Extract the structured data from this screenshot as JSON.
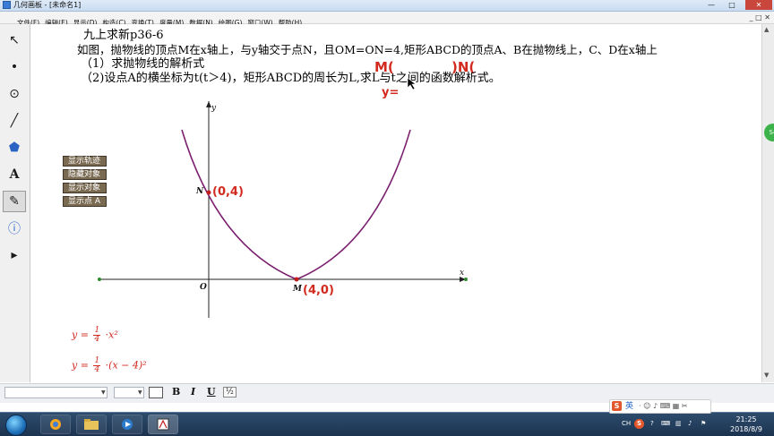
{
  "window": {
    "title": "几何画板 - [未命名1]",
    "minimize_glyph": "—",
    "maximize_glyph": "□",
    "close_glyph": "✕"
  },
  "menu": {
    "items": [
      "文件(F)",
      "编辑(E)",
      "显示(D)",
      "构造(C)",
      "变换(T)",
      "度量(M)",
      "数据(N)",
      "绘图(G)",
      "窗口(W)",
      "帮助(H)"
    ]
  },
  "tools": [
    {
      "name": "selection-arrow-tool",
      "glyph": "↖"
    },
    {
      "name": "point-tool",
      "glyph": "•"
    },
    {
      "name": "compass-tool",
      "glyph": "⊙"
    },
    {
      "name": "straightedge-tool",
      "glyph": "╱"
    },
    {
      "name": "polygon-tool",
      "glyph": "⬟"
    },
    {
      "name": "text-tool",
      "glyph": "A"
    },
    {
      "name": "marker-tool",
      "glyph": "✎"
    },
    {
      "name": "information-tool",
      "glyph": "ⓘ"
    },
    {
      "name": "custom-tool",
      "glyph": "▸"
    }
  ],
  "problem": {
    "line1": "九上求新p36-6",
    "line2": "如图，抛物线的顶点M在x轴上，与y轴交于点N，且OM=ON=4,矩形ABCD的顶点A、B在抛物线上，C、D在x轴上",
    "line3": "（1）求抛物线的解析式",
    "line4": "（2)设点A的横坐标为t(t＞4)，矩形ABCD的周长为L,求L与t之间的函数解析式。"
  },
  "action_buttons": [
    "显示轨迹",
    "隐藏对象",
    "显示对象",
    "显示点 A"
  ],
  "graph": {
    "x_axis_label": "x",
    "y_axis_label": "y",
    "origin_label": "O",
    "point_N_label": "N",
    "point_M_label": "M",
    "annotation_N": "(0,4)",
    "annotation_M": "(4,0)",
    "annotation_top_1": "M(",
    "annotation_top_2": ")N(",
    "annotation_top_3": "y=",
    "curve_color": "#7a1f6e",
    "annotation_color": "#d22a1f"
  },
  "formulas": {
    "f1_lhs": "y =",
    "f1_num": "1",
    "f1_den": "4",
    "f1_rhs": "·x²",
    "f2_lhs": "y =",
    "f2_num": "1",
    "f2_den": "4",
    "f2_rhs": "·(x − 4)²"
  },
  "format_bar": {
    "bold": "B",
    "italic": "I",
    "underline": "U",
    "fraction_icon": "½"
  },
  "taskbar": {
    "clock_time": "21:25",
    "clock_date": "2018/8/9",
    "ime_label": "英",
    "lang": "CH",
    "sogou": "S"
  }
}
